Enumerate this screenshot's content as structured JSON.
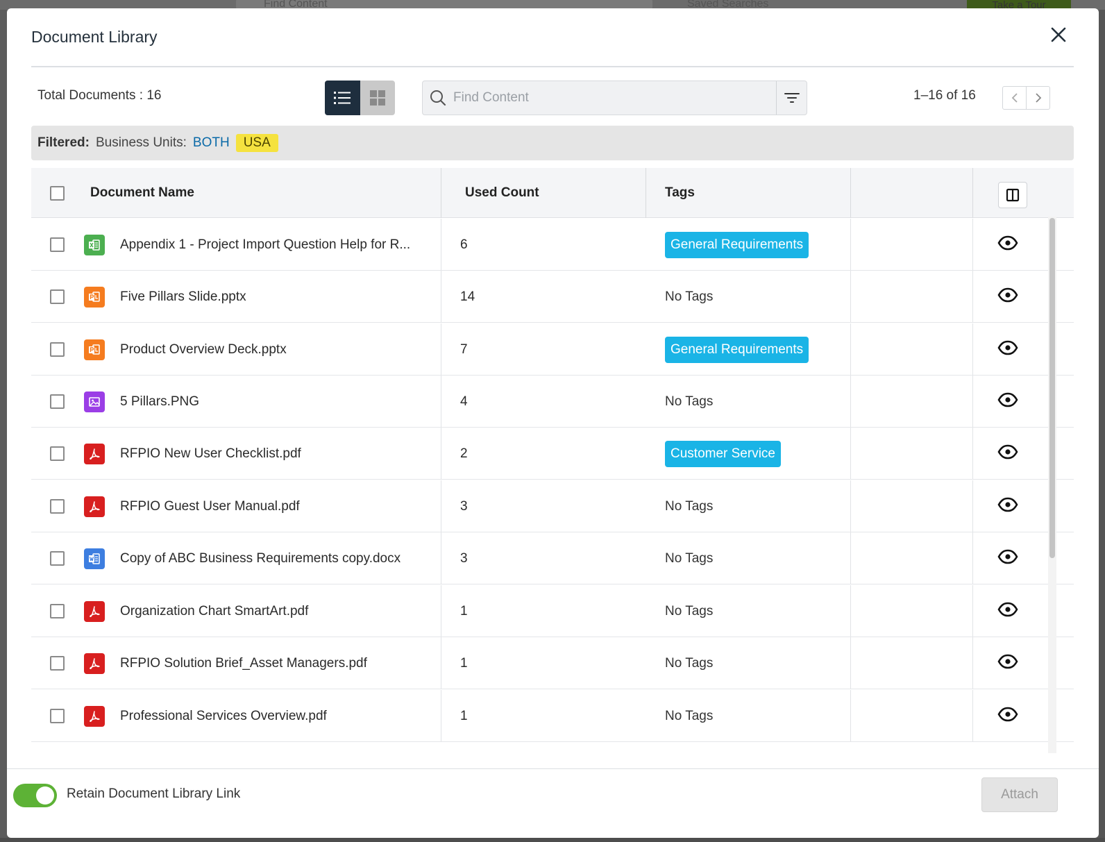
{
  "background": {
    "search_placeholder": "Find Content",
    "saved_searches": "Saved Searches",
    "tour_button": "Take a Tour"
  },
  "modal": {
    "title": "Document Library",
    "close_icon": "close-icon"
  },
  "toolbar": {
    "total_label": "Total Documents : 16",
    "search_placeholder": "Find Content",
    "pagination": "1–16 of 16"
  },
  "filter": {
    "label": "Filtered:",
    "field": "Business Units:",
    "values": [
      "BOTH",
      "USA"
    ]
  },
  "table": {
    "headers": {
      "name": "Document Name",
      "used_count": "Used Count",
      "tags": "Tags"
    },
    "rows": [
      {
        "name": "Appendix 1 - Project Import Question Help for R...",
        "type": "excel",
        "count": "6",
        "tag": "General Requirements"
      },
      {
        "name": "Five Pillars Slide.pptx",
        "type": "powerpoint",
        "count": "14",
        "tag": "No Tags"
      },
      {
        "name": "Product Overview Deck.pptx",
        "type": "powerpoint",
        "count": "7",
        "tag": "General Requirements"
      },
      {
        "name": "5 Pillars.PNG",
        "type": "image",
        "count": "4",
        "tag": "No Tags"
      },
      {
        "name": "RFPIO New User Checklist.pdf",
        "type": "pdf",
        "count": "2",
        "tag": "Customer Service"
      },
      {
        "name": "RFPIO Guest User Manual.pdf",
        "type": "pdf",
        "count": "3",
        "tag": "No Tags"
      },
      {
        "name": "Copy of ABC Business Requirements copy.docx",
        "type": "word",
        "count": "3",
        "tag": "No Tags"
      },
      {
        "name": "Organization Chart SmartArt.pdf",
        "type": "pdf",
        "count": "1",
        "tag": "No Tags"
      },
      {
        "name": "RFPIO Solution Brief_Asset Managers.pdf",
        "type": "pdf",
        "count": "1",
        "tag": "No Tags"
      },
      {
        "name": "Professional Services Overview.pdf",
        "type": "pdf",
        "count": "1",
        "tag": "No Tags"
      }
    ]
  },
  "footer": {
    "toggle_label": "Retain Document Library Link",
    "toggle_on": true,
    "attach_label": "Attach"
  },
  "colors": {
    "tag": "#1ab4e6",
    "toggle": "#5db236",
    "filter_value": "#0b6aa8",
    "usa_badge": "#f5e23f",
    "excel": "#4caf50",
    "powerpoint": "#f57c1f",
    "image": "#9b3ee6",
    "pdf": "#d81f1f",
    "word": "#3d7ee0"
  }
}
